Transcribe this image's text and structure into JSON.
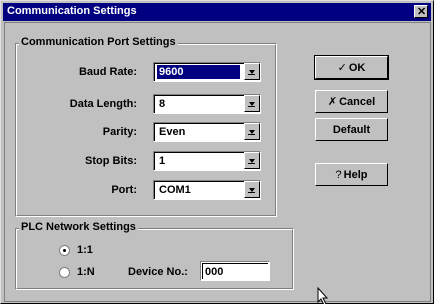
{
  "window": {
    "title": "Communication Settings",
    "close_glyph": "✕"
  },
  "port_settings": {
    "group_label": "Communication Port Settings",
    "fields": [
      {
        "label": "Baud Rate:",
        "value": "9600",
        "selected": true
      },
      {
        "label": "Data Length:",
        "value": "8",
        "selected": false
      },
      {
        "label": "Parity:",
        "value": "Even",
        "selected": false
      },
      {
        "label": "Stop Bits:",
        "value": "1",
        "selected": false
      },
      {
        "label": "Port:",
        "value": "COM1",
        "selected": false
      }
    ]
  },
  "buttons": {
    "ok": {
      "icon": "check-icon",
      "glyph": "✓",
      "label": "OK"
    },
    "cancel": {
      "icon": "x-icon",
      "glyph": "✗",
      "label": "Cancel"
    },
    "default": {
      "label": "Default"
    },
    "help": {
      "icon": "question-icon",
      "glyph": "?",
      "label": "Help"
    }
  },
  "plc_network": {
    "group_label": "PLC Network Settings",
    "options": [
      {
        "label": "1:1",
        "checked": true
      },
      {
        "label": "1:N",
        "checked": false
      }
    ],
    "device_no_label": "Device No.:",
    "device_no_value": "000"
  }
}
